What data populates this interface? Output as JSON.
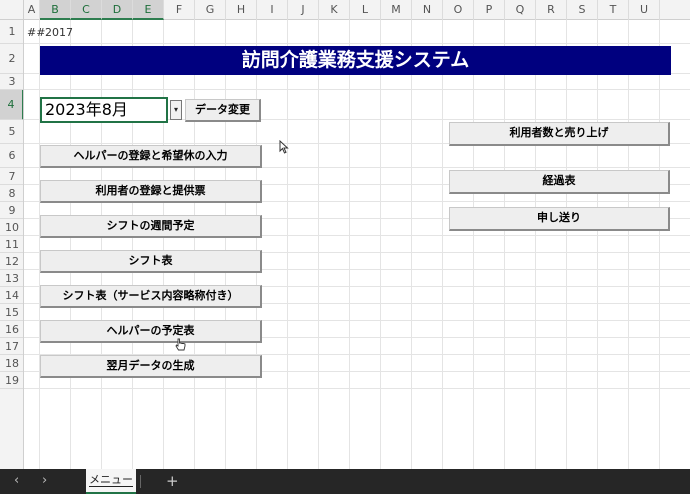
{
  "columns": [
    "A",
    "B",
    "C",
    "D",
    "E",
    "F",
    "G",
    "H",
    "I",
    "J",
    "K",
    "L",
    "M",
    "N",
    "O",
    "P",
    "Q",
    "R",
    "S",
    "T",
    "U"
  ],
  "rows": [
    "1",
    "2",
    "3",
    "4",
    "5",
    "6",
    "7",
    "8",
    "9",
    "10",
    "11",
    "12",
    "13",
    "14",
    "15",
    "16",
    "17",
    "18",
    "19"
  ],
  "cells": {
    "a1": "##",
    "b1": "2017",
    "title": "訪問介護業務支援システム",
    "date_value": "2023年8月",
    "dropdown_glyph": "▾"
  },
  "buttons": {
    "data_change": "データ変更",
    "helper_register": "ヘルパーの登録と希望休の入力",
    "user_register": "利用者の登録と提供票",
    "shift_weekly": "シフトの週間予定",
    "shift_table": "シフト表",
    "shift_table_abbr": "シフト表（サービス内容略称付き）",
    "helper_schedule": "ヘルパーの予定表",
    "next_month": "翌月データの生成",
    "user_count": "利用者数と売り上げ",
    "progress": "経過表",
    "handover": "申し送り"
  },
  "sheetbar": {
    "prev": "‹",
    "next": "›",
    "tab_label": "メニュー",
    "add": "+"
  },
  "colors": {
    "title_bg": "#00007f",
    "accent_green": "#217346"
  }
}
